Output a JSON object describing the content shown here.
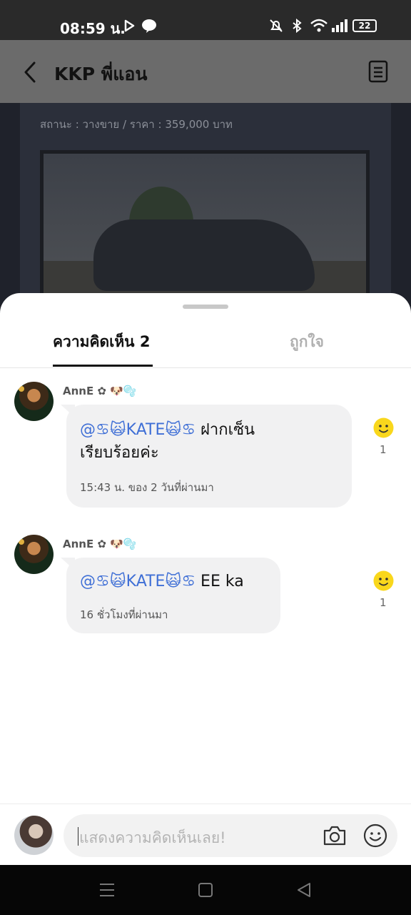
{
  "status_bar": {
    "time": "08:59 น.",
    "battery": "22"
  },
  "header": {
    "title": "KKP พี่แอน"
  },
  "background_post": {
    "status_line": "สถานะ : วางขาย / ราคา : 359,000 บาท"
  },
  "tabs": [
    {
      "label": "ความคิดเห็น 2",
      "active": true
    },
    {
      "label": "ถูกใจ",
      "active": false
    }
  ],
  "comments": [
    {
      "username": "AnnE ✿ 🐶🫧",
      "mention": "@♋🙀KATE🙀♋",
      "text_line1": " ฝากเซ็น",
      "text_line2": "เรียบร้อยค่ะ",
      "time": "15:43 น. ของ 2 วันที่ผ่านมา",
      "likes": "1"
    },
    {
      "username": "AnnE ✿ 🐶🫧",
      "mention": "@♋🙀KATE🙀♋",
      "text_line1": " EE ka",
      "time": "16 ชั่วโมงที่ผ่านมา",
      "likes": "1"
    }
  ],
  "input": {
    "placeholder": "แสดงความคิดเห็นเลย!"
  },
  "colors": {
    "accent_mention": "#3f6fd6",
    "smiley": "#f9d71c"
  }
}
